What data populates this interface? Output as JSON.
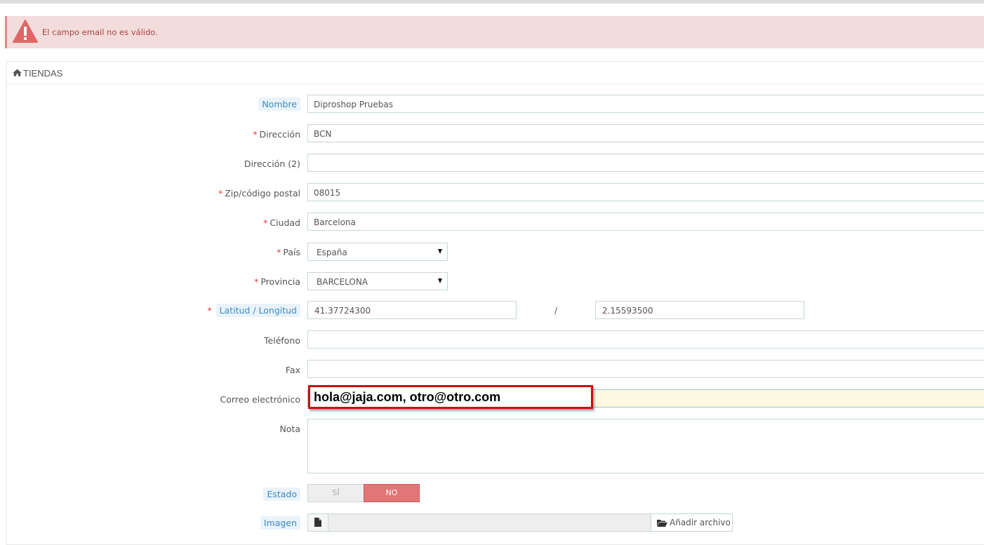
{
  "alert": {
    "message": "El campo email no es válido."
  },
  "panel": {
    "title": "TIENDAS"
  },
  "form": {
    "nombre": {
      "label": "Nombre",
      "value": "Diproshop Pruebas"
    },
    "direccion": {
      "label": "Dirección",
      "value": "BCN"
    },
    "direccion2": {
      "label": "Dirección (2)",
      "value": ""
    },
    "zip": {
      "label": "Zip/código postal",
      "value": "08015"
    },
    "ciudad": {
      "label": "Ciudad",
      "value": "Barcelona"
    },
    "pais": {
      "label": "País",
      "selected": "España"
    },
    "provincia": {
      "label": "Provincia",
      "selected": "BARCELONA"
    },
    "latlon": {
      "label": "Latitud / Longitud",
      "lat": "41.37724300",
      "separator": "/",
      "lon": "2.15593500"
    },
    "telefono": {
      "label": "Teléfono",
      "value": ""
    },
    "fax": {
      "label": "Fax",
      "value": ""
    },
    "correo": {
      "label": "Correo electrónico",
      "value": "hola@jaja.com, otro@otro.com"
    },
    "nota": {
      "label": "Nota",
      "value": ""
    },
    "estado": {
      "label": "Estado",
      "yes": "SÍ",
      "no": "NO",
      "selected": "NO"
    },
    "imagen": {
      "label": "Imagen",
      "button": "Añadir archivo"
    }
  },
  "required_marker": "*",
  "colors": {
    "alert_bg": "#f3dcdc",
    "alert_text": "#a94442",
    "required": "#e34040",
    "hint_text": "#3d8cc1",
    "toggle_no": "#e27575",
    "callout_border": "#cc0d0d"
  },
  "icons": {
    "alert": "warning-triangle-icon",
    "panel": "home-icon",
    "file": "file-icon",
    "folder": "folder-open-icon"
  }
}
